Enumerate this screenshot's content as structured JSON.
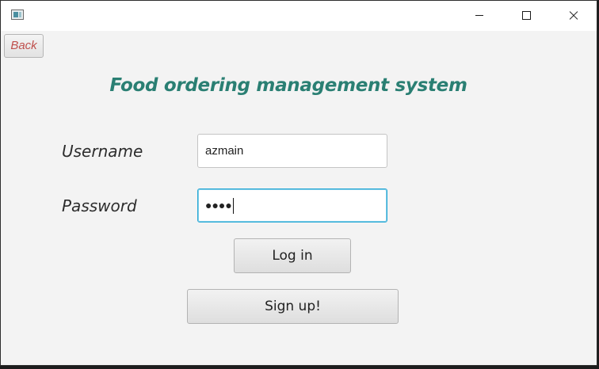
{
  "window": {
    "icon": "java-app-icon",
    "controls": {
      "minimize": "minimize-icon",
      "maximize": "maximize-icon",
      "close": "close-icon"
    }
  },
  "toolbar": {
    "back_label": "Back"
  },
  "page": {
    "title": "Food ordering management system"
  },
  "form": {
    "username_label": "Username",
    "username_value": "azmain",
    "password_label": "Password",
    "password_masked": "●●●●"
  },
  "actions": {
    "login_label": "Log in",
    "signup_label": "Sign up!"
  },
  "colors": {
    "title": "#2a7f73",
    "back_text": "#c0504d",
    "focus_border": "#28a9d6",
    "background": "#f3f3f3"
  }
}
